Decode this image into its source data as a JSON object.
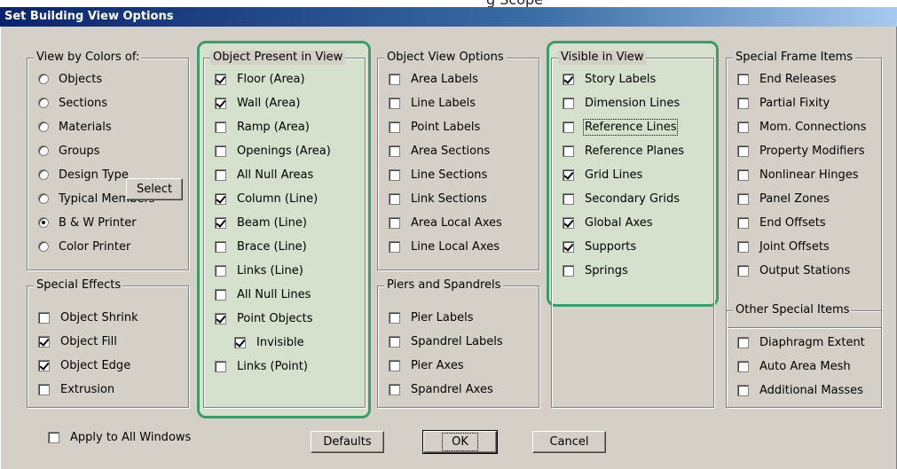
{
  "top_fragment": "g  Scope",
  "title": "Set Building View Options",
  "view_by_colors": {
    "label": "View by Colors of:",
    "options": [
      "Objects",
      "Sections",
      "Materials",
      "Groups",
      "Design Type",
      "Typical Members",
      "B & W Printer",
      "Color Printer"
    ],
    "selected": "B & W Printer",
    "select_button": "Select"
  },
  "special_effects": {
    "label": "Special Effects",
    "items": [
      {
        "label": "Object Shrink",
        "checked": false
      },
      {
        "label": "Object Fill",
        "checked": true
      },
      {
        "label": "Object Edge",
        "checked": true
      },
      {
        "label": "Extrusion",
        "checked": false
      }
    ]
  },
  "object_present": {
    "label": "Object Present in View",
    "items": [
      {
        "label": "Floor (Area)",
        "checked": true
      },
      {
        "label": "Wall (Area)",
        "checked": true
      },
      {
        "label": "Ramp (Area)",
        "checked": false
      },
      {
        "label": "Openings (Area)",
        "checked": false
      },
      {
        "label": "All Null Areas",
        "checked": false
      },
      {
        "label": "Column (Line)",
        "checked": true
      },
      {
        "label": "Beam (Line)",
        "checked": true
      },
      {
        "label": "Brace (Line)",
        "checked": false
      },
      {
        "label": "Links (Line)",
        "checked": false
      },
      {
        "label": "All Null Lines",
        "checked": false
      },
      {
        "label": "Point Objects",
        "checked": true
      },
      {
        "label": "Invisible",
        "checked": true
      },
      {
        "label": "Links (Point)",
        "checked": false
      }
    ]
  },
  "object_view_options": {
    "label": "Object View Options",
    "items": [
      {
        "label": "Area Labels",
        "checked": false
      },
      {
        "label": "Line Labels",
        "checked": false
      },
      {
        "label": "Point Labels",
        "checked": false
      },
      {
        "label": "Area Sections",
        "checked": false
      },
      {
        "label": "Line Sections",
        "checked": false
      },
      {
        "label": "Link Sections",
        "checked": false
      },
      {
        "label": "Area Local Axes",
        "checked": false
      },
      {
        "label": "Line Local Axes",
        "checked": false
      }
    ]
  },
  "piers_spandrels": {
    "label": "Piers and Spandrels",
    "items": [
      {
        "label": "Pier Labels",
        "checked": false
      },
      {
        "label": "Spandrel Labels",
        "checked": false
      },
      {
        "label": "Pier Axes",
        "checked": false
      },
      {
        "label": "Spandrel Axes",
        "checked": false
      }
    ]
  },
  "visible_in_view": {
    "label": "Visible in View",
    "items": [
      {
        "label": "Story Labels",
        "checked": true
      },
      {
        "label": "Dimension Lines",
        "checked": false
      },
      {
        "label": "Reference Lines",
        "checked": false
      },
      {
        "label": "Reference Planes",
        "checked": false
      },
      {
        "label": "Grid Lines",
        "checked": true
      },
      {
        "label": "Secondary Grids",
        "checked": false
      },
      {
        "label": "Global Axes",
        "checked": true
      },
      {
        "label": "Supports",
        "checked": true
      },
      {
        "label": "Springs",
        "checked": false
      }
    ]
  },
  "special_frame": {
    "label": "Special Frame Items",
    "items": [
      {
        "label": "End Releases",
        "checked": false
      },
      {
        "label": "Partial Fixity",
        "checked": false
      },
      {
        "label": "Mom. Connections",
        "checked": false
      },
      {
        "label": "Property Modifiers",
        "checked": false
      },
      {
        "label": "Nonlinear Hinges",
        "checked": false
      },
      {
        "label": "Panel Zones",
        "checked": false
      },
      {
        "label": "End Offsets",
        "checked": false
      },
      {
        "label": "Joint Offsets",
        "checked": false
      },
      {
        "label": "Output Stations",
        "checked": false
      }
    ]
  },
  "other_special": {
    "label": "Other Special Items",
    "items": [
      {
        "label": "Diaphragm Extent",
        "checked": false
      },
      {
        "label": "Auto Area Mesh",
        "checked": false
      },
      {
        "label": "Additional Masses",
        "checked": false
      }
    ]
  },
  "apply_all": {
    "label": "Apply to All Windows",
    "checked": false
  },
  "buttons": {
    "defaults": "Defaults",
    "ok": "OK",
    "cancel": "Cancel"
  },
  "colors": {
    "highlight_border": "#3e9c68",
    "highlight_fill": "#d6e8cd",
    "title_bg": "#0a246a",
    "face": "#d4d0c8"
  }
}
